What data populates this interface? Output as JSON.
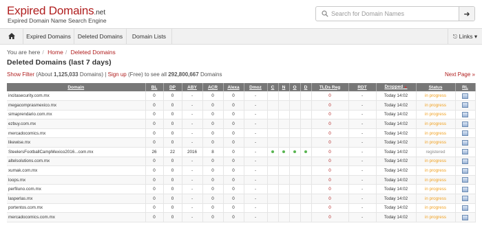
{
  "logo": {
    "part1": "Expired",
    "part2": " Domains",
    "tld": ".net"
  },
  "tagline": "Expired Domain Name Search Engine",
  "search": {
    "placeholder": "Search for Domain Names",
    "button": "➜"
  },
  "nav": {
    "items": [
      "Expired Domains",
      "Deleted Domains",
      "Domain Lists"
    ],
    "links": "Links ▾"
  },
  "breadcrumb": {
    "prefix": "You are here",
    "home": "Home",
    "current": "Deleted Domains"
  },
  "page_title": "Deleted Domains (last 7 days)",
  "info": {
    "show_filter": "Show Filter",
    "about_prefix": " (About ",
    "count": "1,125,033",
    "about_suffix": " Domains) | ",
    "signup": "Sign up",
    "signup_suffix": " (Free) to see all ",
    "total": "292,800,667",
    "total_suffix": " Domains"
  },
  "next_page": "Next Page »",
  "columns": [
    "Domain",
    "BL",
    "DP",
    "ABY",
    "ACR",
    "Alexa",
    "Dmoz",
    "C",
    "N",
    "O",
    "D",
    "TLDs Reg",
    "RDT",
    "Dropped",
    "Status",
    "RL"
  ],
  "colors": {
    "accent": "#b01e1e",
    "header_bg": "#777777",
    "status": "#f0a020",
    "dot": "#5ab552"
  },
  "rows": [
    {
      "domain": "incitasecurity.com.mx",
      "bl": "0",
      "dp": "0",
      "aby": "-",
      "acr": "0",
      "alexa": "0",
      "dmoz": "-",
      "dots": false,
      "tlds": "0",
      "rdt": "-",
      "dropped": "Today 14:02",
      "status": "in progress"
    },
    {
      "domain": "megacomprasmexico.mx",
      "bl": "0",
      "dp": "0",
      "aby": "-",
      "acr": "0",
      "alexa": "0",
      "dmoz": "-",
      "dots": false,
      "tlds": "0",
      "rdt": "-",
      "dropped": "Today 14:02",
      "status": "in progress"
    },
    {
      "domain": "simaprendario.com.mx",
      "bl": "0",
      "dp": "0",
      "aby": "-",
      "acr": "0",
      "alexa": "0",
      "dmoz": "-",
      "dots": false,
      "tlds": "0",
      "rdt": "-",
      "dropped": "Today 14:02",
      "status": "in progress"
    },
    {
      "domain": "ezbuy.com.mx",
      "bl": "0",
      "dp": "0",
      "aby": "-",
      "acr": "0",
      "alexa": "0",
      "dmoz": "-",
      "dots": false,
      "tlds": "0",
      "rdt": "-",
      "dropped": "Today 14:02",
      "status": "in progress"
    },
    {
      "domain": "mercadocomics.mx",
      "bl": "0",
      "dp": "0",
      "aby": "-",
      "acr": "0",
      "alexa": "0",
      "dmoz": "-",
      "dots": false,
      "tlds": "0",
      "rdt": "-",
      "dropped": "Today 14:02",
      "status": "in progress"
    },
    {
      "domain": "likewise.mx",
      "bl": "0",
      "dp": "0",
      "aby": "-",
      "acr": "0",
      "alexa": "0",
      "dmoz": "-",
      "dots": false,
      "tlds": "0",
      "rdt": "-",
      "dropped": "Today 14:02",
      "status": "in progress"
    },
    {
      "domain": "SteelersFootballCampMexico2016...com.mx",
      "bl": "26",
      "dp": "22",
      "aby": "2016",
      "acr": "8",
      "alexa": "0",
      "dmoz": "-",
      "dots": true,
      "tlds": "0",
      "rdt": "-",
      "dropped": "Today 14:02",
      "status": "registered"
    },
    {
      "domain": "altelsolutions.com.mx",
      "bl": "0",
      "dp": "0",
      "aby": "-",
      "acr": "0",
      "alexa": "0",
      "dmoz": "-",
      "dots": false,
      "tlds": "0",
      "rdt": "-",
      "dropped": "Today 14:02",
      "status": "in progress"
    },
    {
      "domain": "xumak.com.mx",
      "bl": "0",
      "dp": "0",
      "aby": "-",
      "acr": "0",
      "alexa": "0",
      "dmoz": "-",
      "dots": false,
      "tlds": "0",
      "rdt": "-",
      "dropped": "Today 14:02",
      "status": "in progress"
    },
    {
      "domain": "loops.mx",
      "bl": "0",
      "dp": "0",
      "aby": "-",
      "acr": "0",
      "alexa": "0",
      "dmoz": "-",
      "dots": false,
      "tlds": "0",
      "rdt": "-",
      "dropped": "Today 14:02",
      "status": "in progress"
    },
    {
      "domain": "perfiluno.com.mx",
      "bl": "0",
      "dp": "0",
      "aby": "-",
      "acr": "0",
      "alexa": "0",
      "dmoz": "-",
      "dots": false,
      "tlds": "0",
      "rdt": "-",
      "dropped": "Today 14:02",
      "status": "in progress"
    },
    {
      "domain": "lasperlas.mx",
      "bl": "0",
      "dp": "0",
      "aby": "-",
      "acr": "0",
      "alexa": "0",
      "dmoz": "-",
      "dots": false,
      "tlds": "0",
      "rdt": "-",
      "dropped": "Today 14:02",
      "status": "in progress"
    },
    {
      "domain": "portentos.com.mx",
      "bl": "0",
      "dp": "0",
      "aby": "-",
      "acr": "0",
      "alexa": "0",
      "dmoz": "-",
      "dots": false,
      "tlds": "0",
      "rdt": "-",
      "dropped": "Today 14:02",
      "status": "in progress"
    },
    {
      "domain": "mercadocomics.com.mx",
      "bl": "0",
      "dp": "0",
      "aby": "-",
      "acr": "0",
      "alexa": "0",
      "dmoz": "-",
      "dots": false,
      "tlds": "0",
      "rdt": "-",
      "dropped": "Today 14:02",
      "status": "in progress"
    }
  ]
}
